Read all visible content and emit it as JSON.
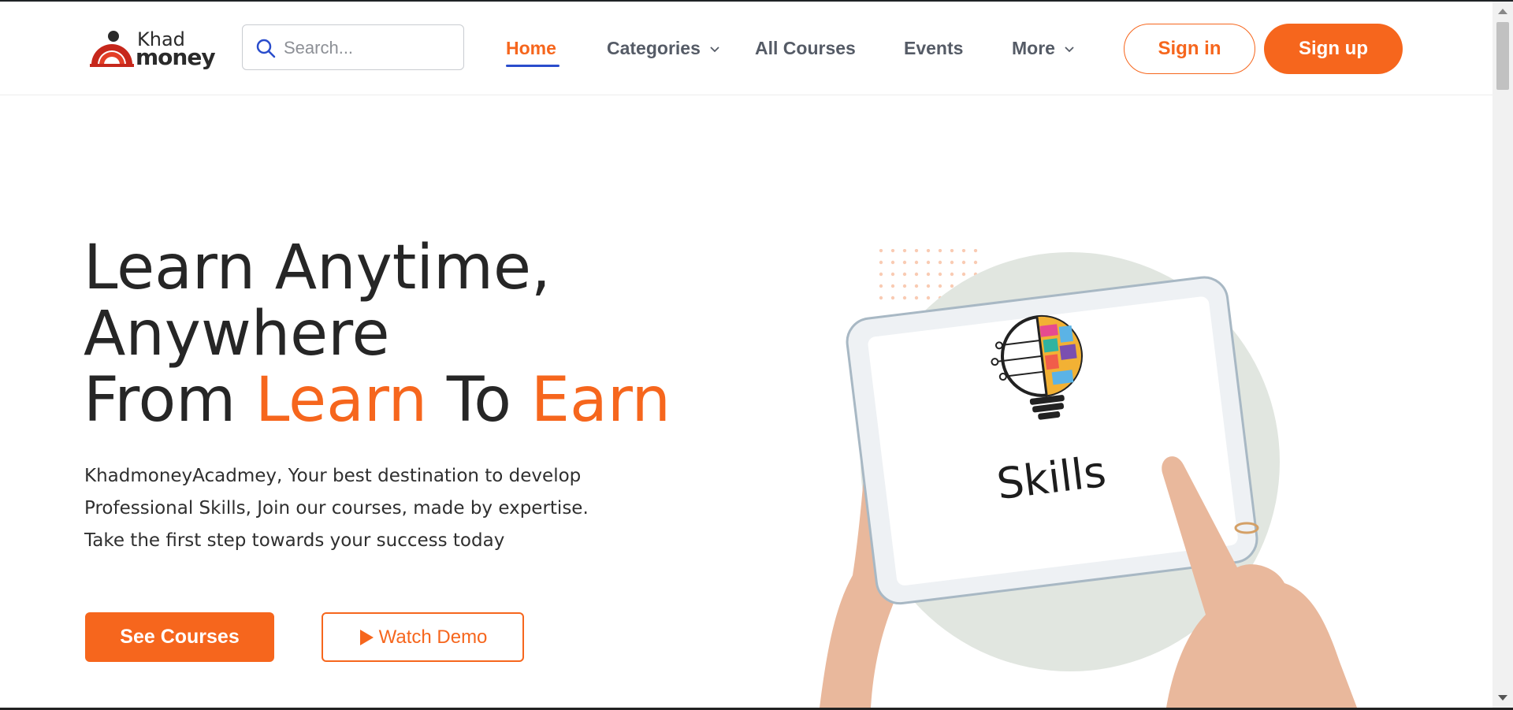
{
  "header": {
    "logo": {
      "line1": "Khad",
      "line2": "money",
      "icon": "user-arch-logo-icon"
    },
    "search": {
      "placeholder": "Search...",
      "value": "",
      "icon": "search-icon"
    },
    "nav": [
      {
        "label": "Home",
        "active": true
      },
      {
        "label": "Categories",
        "dropdown": true
      },
      {
        "label": "All Courses"
      },
      {
        "label": "Events"
      },
      {
        "label": "More",
        "dropdown": true
      }
    ],
    "signin_label": "Sign in",
    "signup_label": "Sign up"
  },
  "hero": {
    "title_line1": "Learn Anytime,",
    "title_line2": "Anywhere",
    "title_line3_a": "From ",
    "title_line3_b": "Learn",
    "title_line3_c": " To ",
    "title_line3_d": "Earn",
    "desc_line1": "KhadmoneyAcadmey, Your best destination to develop",
    "desc_line2": "Professional Skills, Join our courses, made by expertise.",
    "desc_line3": "Take the first step towards your success today",
    "see_courses_label": "See Courses",
    "watch_demo_label": "Watch Demo",
    "illustration_text": "Skills"
  },
  "colors": {
    "accent": "#f6661d",
    "nav_text": "#555b66",
    "active_underline": "#2a4dcc",
    "circle_bg": "#e1e6e0"
  }
}
